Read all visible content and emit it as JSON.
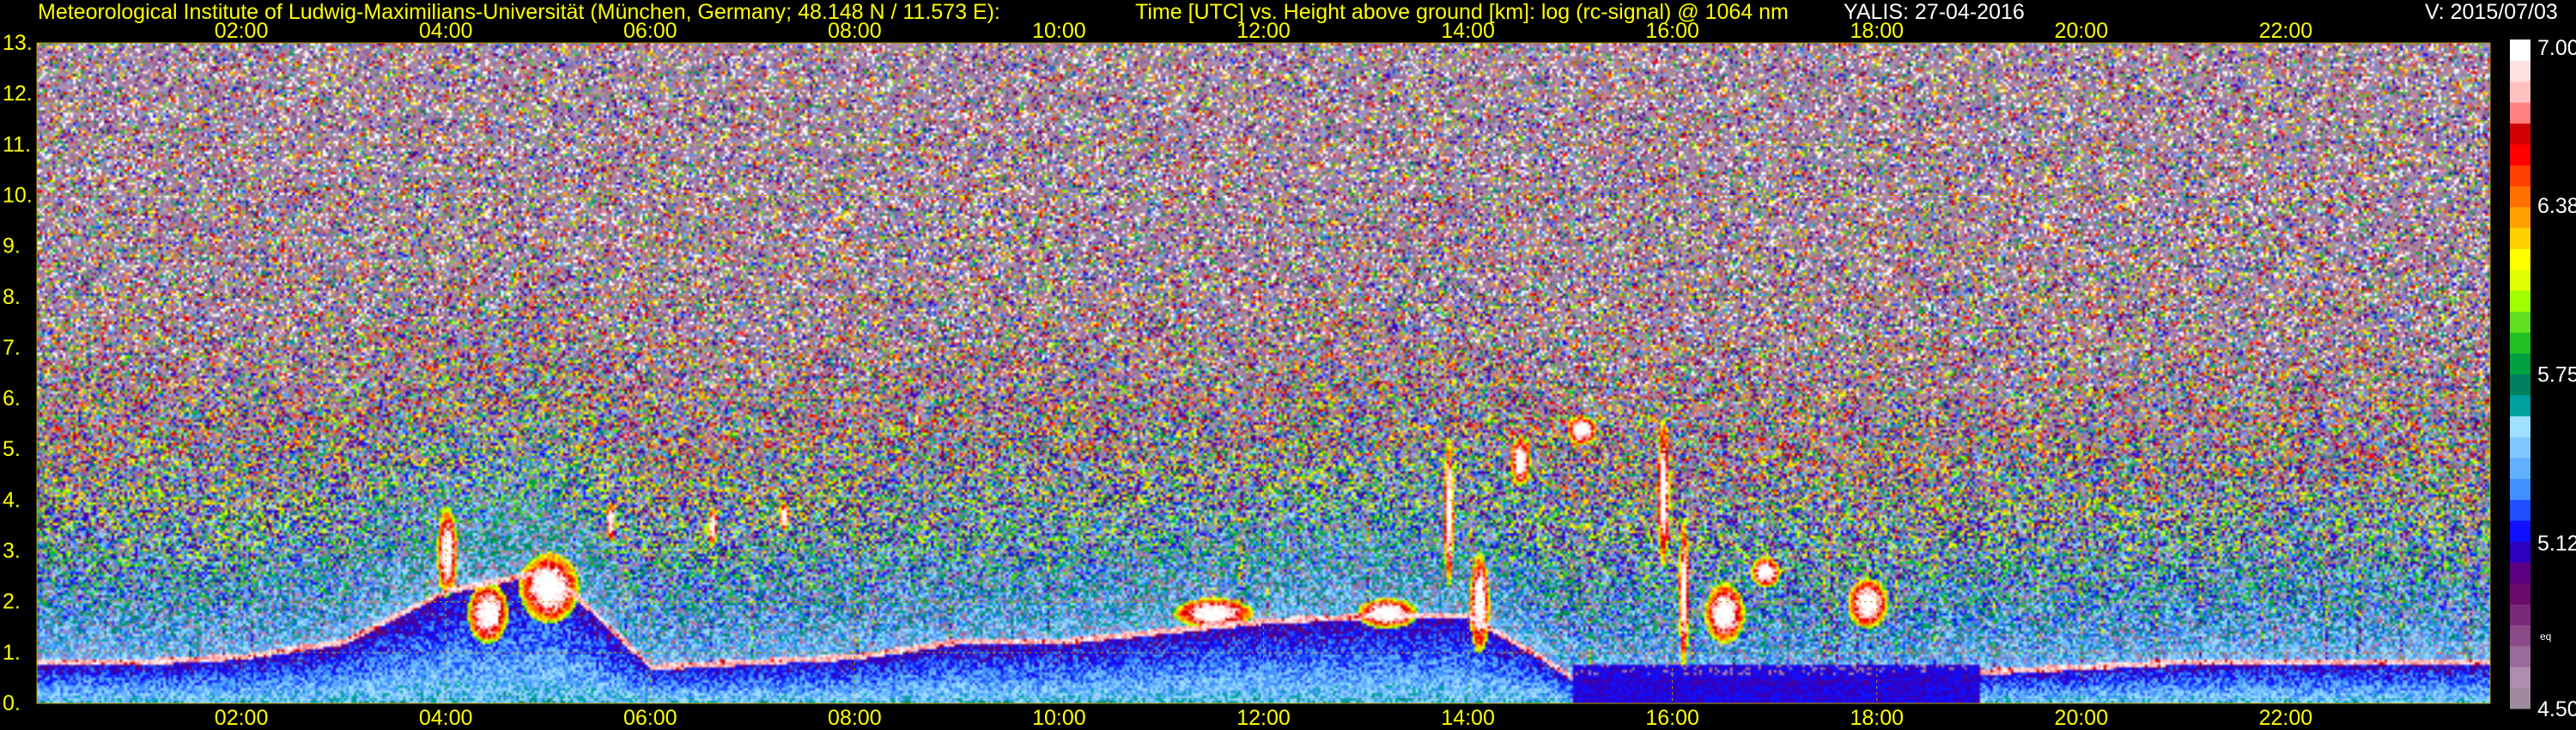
{
  "header": {
    "institute": "Meteorological Institute of Ludwig-Maximilians-Universität (München, Germany; 48.148 N / 11.573 E):",
    "description": "Time [UTC] vs. Height above ground [km]: log (rc-signal) @ 1064 nm",
    "instrument": "YALIS: 27-04-2016",
    "version": "V: 2015/07/03"
  },
  "colors": {
    "background": "#000000",
    "axis_text": "#ffff00",
    "grid": "#b8a000"
  },
  "chart_data": {
    "type": "heatmap",
    "title": "Time [UTC] vs. Height above ground [km]: log (rc-signal) @ 1064 nm",
    "xlabel": "",
    "ylabel": "",
    "xlim": [
      0,
      24
    ],
    "ylim": [
      0,
      13
    ],
    "x_ticks": [
      "02:00",
      "04:00",
      "06:00",
      "08:00",
      "10:00",
      "12:00",
      "14:00",
      "16:00",
      "18:00",
      "20:00",
      "22:00"
    ],
    "x_tick_values": [
      2,
      4,
      6,
      8,
      10,
      12,
      14,
      16,
      18,
      20,
      22
    ],
    "y_ticks": [
      "1.",
      "2.",
      "3.",
      "4.",
      "5.",
      "6.",
      "7.",
      "8.",
      "9.",
      "10.",
      "11.",
      "12.",
      "13."
    ],
    "y_tick_values": [
      1,
      2,
      3,
      4,
      5,
      6,
      7,
      8,
      9,
      10,
      11,
      12,
      13
    ],
    "grid": true,
    "colorbar": {
      "range": [
        4.5,
        7.0
      ],
      "tick_labels": [
        "7.00",
        "6.38",
        "5.75",
        "5.12",
        "4.50"
      ],
      "tick_values": [
        7.0,
        6.38,
        5.75,
        5.12,
        4.5
      ],
      "extra_label": "eq",
      "colors": [
        "#a08aa0",
        "#b08cb0",
        "#9a6a9a",
        "#8a4a8a",
        "#7a2a7a",
        "#6a0a6a",
        "#5a0080",
        "#3000c0",
        "#1010ff",
        "#2050ff",
        "#4090ff",
        "#60b0ff",
        "#80c8ff",
        "#a0e0ff",
        "#00a0a0",
        "#008060",
        "#00a040",
        "#20c020",
        "#60e020",
        "#a0ff00",
        "#e0ff00",
        "#ffff00",
        "#ffd000",
        "#ffa000",
        "#ff7000",
        "#ff4000",
        "#ff0000",
        "#d00000",
        "#ff8080",
        "#ffc0c0",
        "#ffe0e0",
        "#ffffff"
      ]
    },
    "features": {
      "boundary_layer": [
        [
          0.0,
          0.9
        ],
        [
          1.0,
          0.9
        ],
        [
          2.0,
          1.0
        ],
        [
          3.0,
          1.3
        ],
        [
          4.0,
          2.3
        ],
        [
          5.0,
          2.7
        ],
        [
          6.0,
          0.8
        ],
        [
          7.0,
          0.9
        ],
        [
          8.0,
          1.0
        ],
        [
          9.0,
          1.3
        ],
        [
          10.0,
          1.3
        ],
        [
          11.0,
          1.5
        ],
        [
          12.0,
          1.7
        ],
        [
          13.0,
          1.8
        ],
        [
          14.0,
          1.8
        ],
        [
          14.7,
          1.0
        ],
        [
          15.0,
          0.6
        ],
        [
          16.0,
          0.6
        ],
        [
          17.0,
          0.6
        ],
        [
          18.0,
          0.6
        ],
        [
          19.0,
          0.7
        ],
        [
          20.0,
          0.8
        ],
        [
          21.0,
          0.9
        ],
        [
          22.0,
          0.9
        ],
        [
          24.0,
          0.9
        ]
      ],
      "clouds": [
        [
          4.0,
          3.0,
          0.1,
          0.9
        ],
        [
          4.4,
          1.8,
          0.2,
          0.6
        ],
        [
          5.0,
          2.3,
          0.3,
          0.7
        ],
        [
          5.6,
          3.6,
          0.05,
          0.4
        ],
        [
          6.6,
          3.5,
          0.05,
          0.4
        ],
        [
          7.3,
          3.7,
          0.05,
          0.3
        ],
        [
          8.6,
          5.6,
          0.03,
          0.2
        ],
        [
          11.5,
          1.8,
          0.4,
          0.3
        ],
        [
          13.2,
          1.8,
          0.3,
          0.3
        ],
        [
          13.8,
          3.8,
          0.05,
          1.5
        ],
        [
          14.1,
          2.0,
          0.1,
          1.0
        ],
        [
          14.5,
          4.8,
          0.1,
          0.5
        ],
        [
          15.1,
          5.4,
          0.15,
          0.3
        ],
        [
          15.9,
          4.2,
          0.06,
          1.5
        ],
        [
          16.1,
          2.2,
          0.05,
          1.5
        ],
        [
          16.5,
          1.8,
          0.2,
          0.6
        ],
        [
          16.9,
          2.6,
          0.15,
          0.3
        ],
        [
          17.9,
          2.0,
          0.2,
          0.5
        ]
      ]
    }
  }
}
